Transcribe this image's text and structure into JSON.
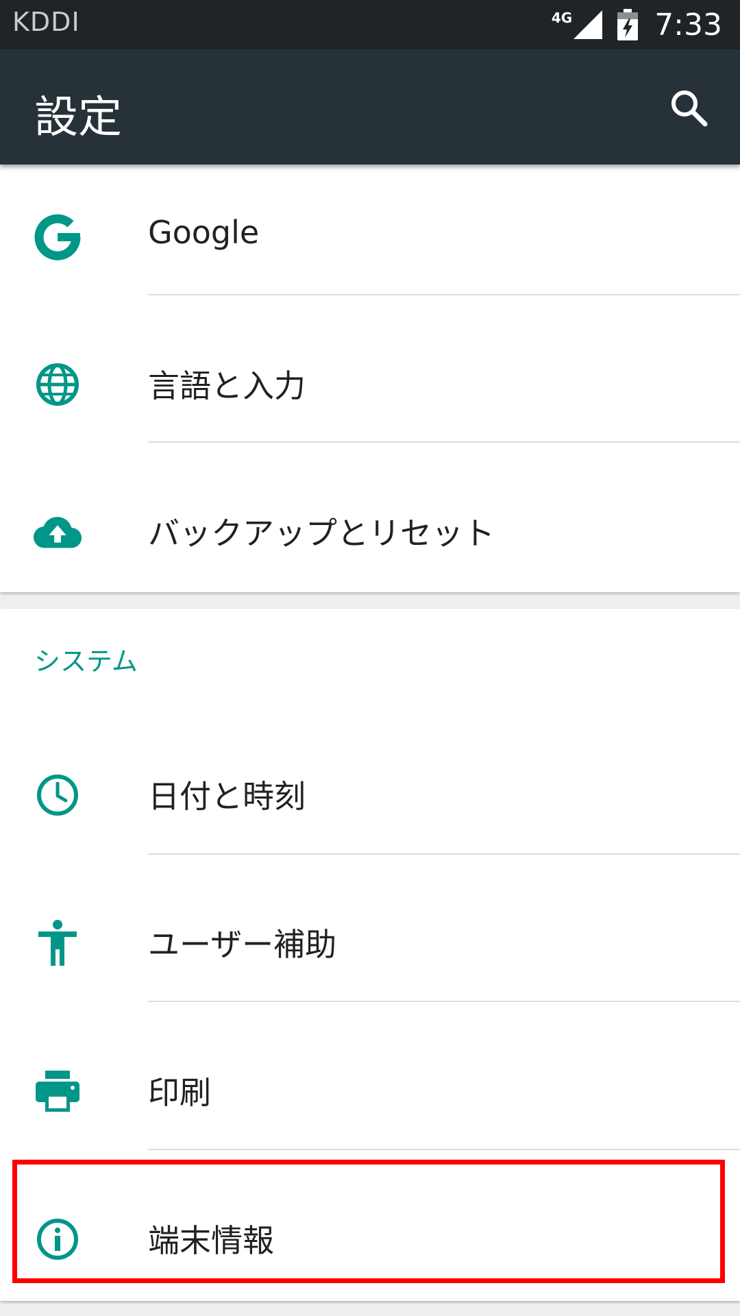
{
  "status_bar": {
    "carrier": "KDDI",
    "network_type": "4G",
    "time": "7:33"
  },
  "app_bar": {
    "title": "設定",
    "search_icon": "search-icon"
  },
  "accent_color": "#009688",
  "personal_items": [
    {
      "label": "Google",
      "icon": "google-icon"
    },
    {
      "label": "言語と入力",
      "icon": "globe-icon"
    },
    {
      "label": "バックアップとリセット",
      "icon": "cloud-upload-icon"
    }
  ],
  "system_section": {
    "header": "システム",
    "items": [
      {
        "label": "日付と時刻",
        "icon": "clock-icon"
      },
      {
        "label": "ユーザー補助",
        "icon": "accessibility-icon"
      },
      {
        "label": "印刷",
        "icon": "print-icon"
      },
      {
        "label": "端末情報",
        "icon": "info-icon"
      }
    ]
  }
}
